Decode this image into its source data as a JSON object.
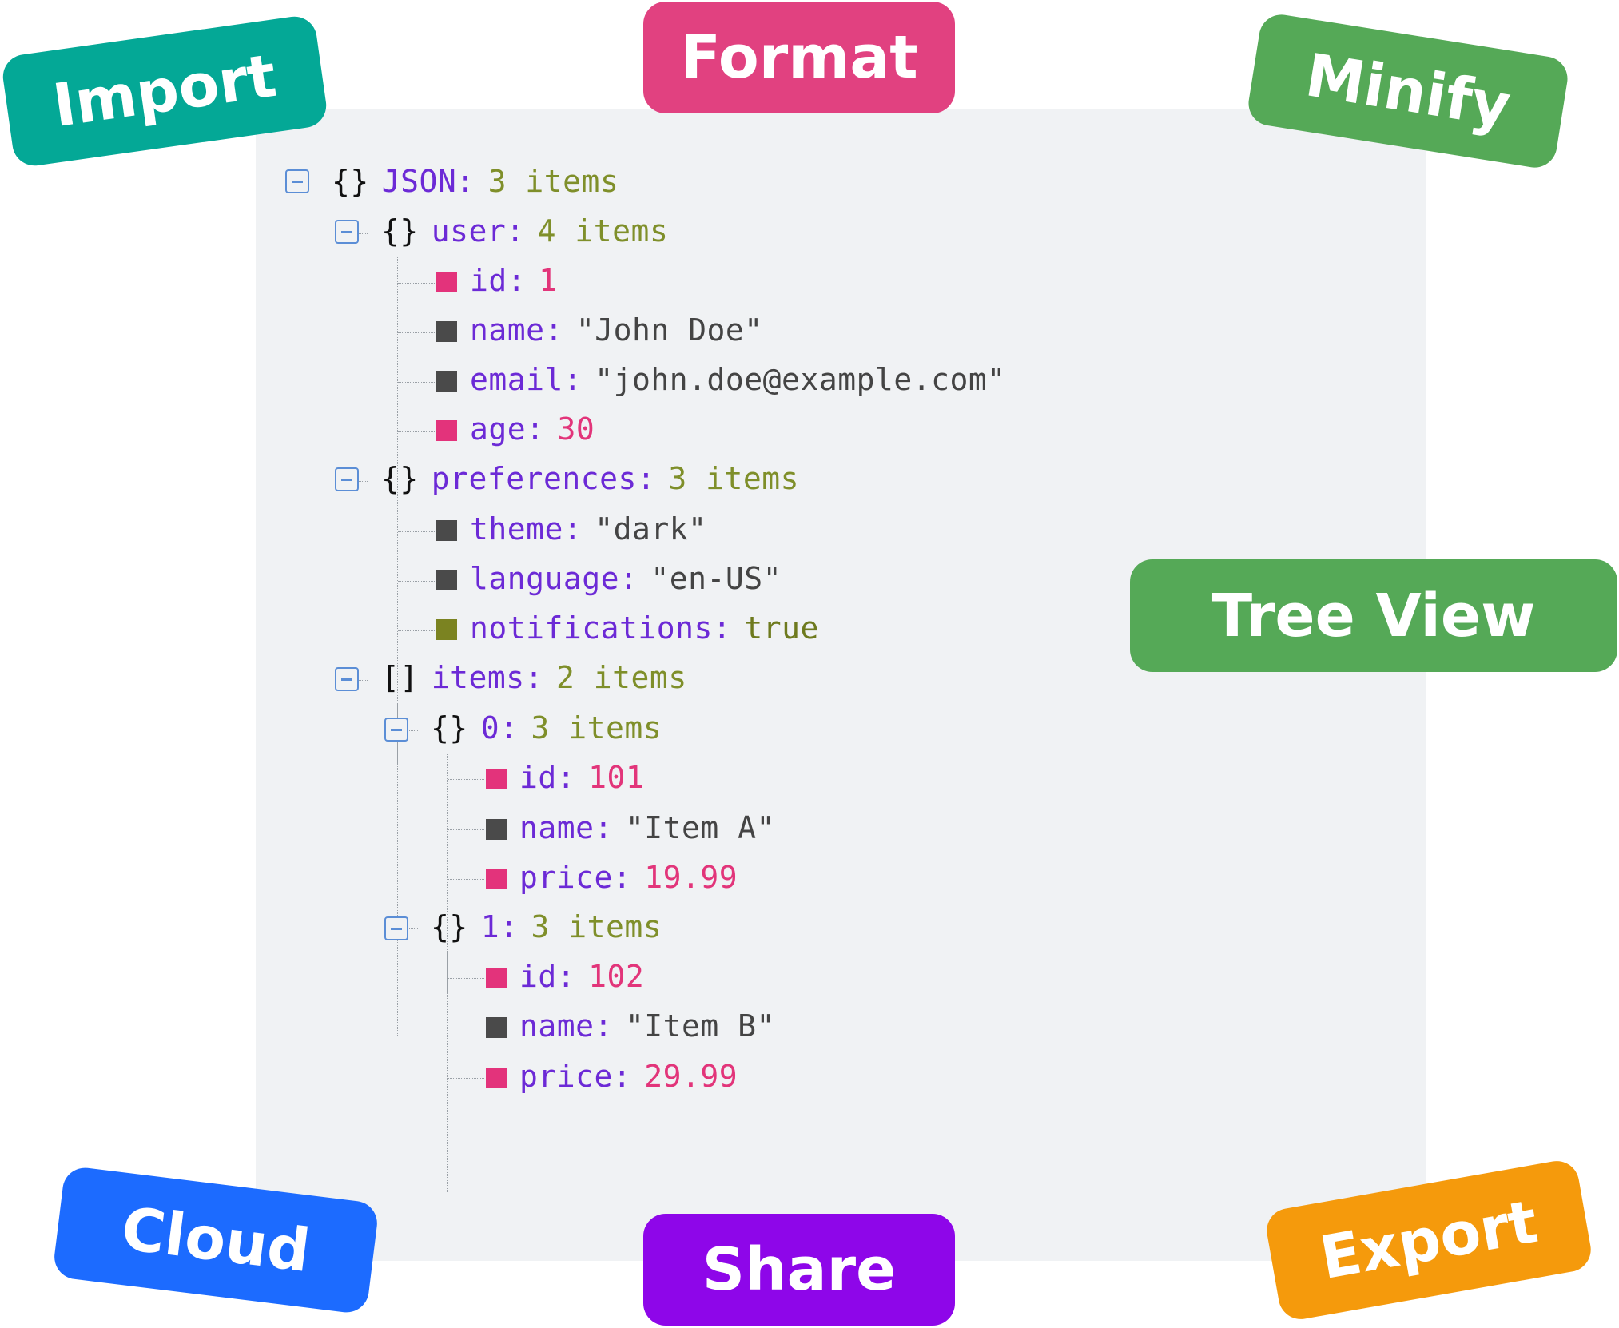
{
  "tags": {
    "import": {
      "label": "Import",
      "color": "#04a896"
    },
    "format": {
      "label": "Format",
      "color": "#e14180"
    },
    "minify": {
      "label": "Minify",
      "color": "#55a957"
    },
    "tree_view": {
      "label": "Tree View",
      "color": "#55a957"
    },
    "cloud": {
      "label": "Cloud",
      "color": "#1c6bff"
    },
    "share": {
      "label": "Share",
      "color": "#8e06e9"
    },
    "export": {
      "label": "Export",
      "color": "#f59a0c"
    }
  },
  "tree": {
    "root": {
      "brace": "{}",
      "key": "JSON",
      "count": "3 items"
    },
    "user": {
      "brace": "{}",
      "key": "user",
      "count": "4 items",
      "fields": [
        {
          "key": "id",
          "value": "1",
          "type": "number"
        },
        {
          "key": "name",
          "value": "\"John Doe\"",
          "type": "string"
        },
        {
          "key": "email",
          "value": "\"john.doe@example.com\"",
          "type": "string"
        },
        {
          "key": "age",
          "value": "30",
          "type": "number"
        }
      ]
    },
    "preferences": {
      "brace": "{}",
      "key": "preferences",
      "count": "3 items",
      "fields": [
        {
          "key": "theme",
          "value": "\"dark\"",
          "type": "string"
        },
        {
          "key": "language",
          "value": "\"en-US\"",
          "type": "string"
        },
        {
          "key": "notifications",
          "value": "true",
          "type": "boolean"
        }
      ]
    },
    "items": {
      "brace": "[]",
      "key": "items",
      "count": "2 items",
      "elements": [
        {
          "brace": "{}",
          "key": "0",
          "count": "3 items",
          "fields": [
            {
              "key": "id",
              "value": "101",
              "type": "number"
            },
            {
              "key": "name",
              "value": "\"Item A\"",
              "type": "string"
            },
            {
              "key": "price",
              "value": "19.99",
              "type": "number"
            }
          ]
        },
        {
          "brace": "{}",
          "key": "1",
          "count": "3 items",
          "fields": [
            {
              "key": "id",
              "value": "102",
              "type": "number"
            },
            {
              "key": "name",
              "value": "\"Item B\"",
              "type": "string"
            },
            {
              "key": "price",
              "value": "29.99",
              "type": "number"
            }
          ]
        }
      ]
    }
  }
}
